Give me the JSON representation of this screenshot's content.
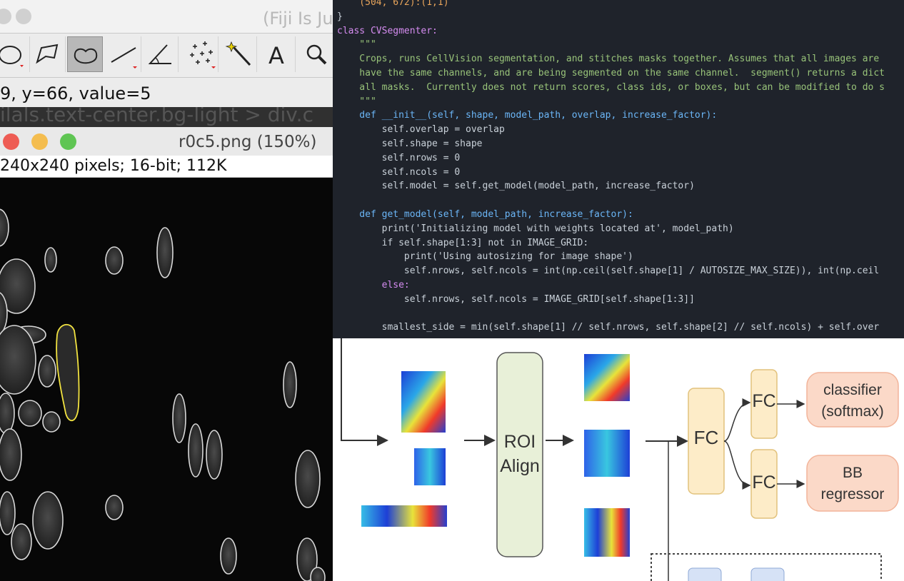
{
  "fiji": {
    "title": "(Fiji Is Ju",
    "status": "9, y=66, value=5",
    "dev_breadcrumb": "ilals.text-center.bg-light  >  div.c",
    "tools": [
      {
        "name": "oval-selection",
        "icon": "oval-selection-icon"
      },
      {
        "name": "polygon-selection",
        "icon": "polygon-selection-icon"
      },
      {
        "name": "freehand-selection",
        "icon": "freehand-selection-icon",
        "active": true
      },
      {
        "name": "line-selection",
        "icon": "line-icon"
      },
      {
        "name": "angle-tool",
        "icon": "angle-icon"
      },
      {
        "name": "multi-point-tool",
        "icon": "multipoint-icon"
      },
      {
        "name": "wand-tool",
        "icon": "wand-icon"
      },
      {
        "name": "text-tool",
        "icon": "text-icon"
      },
      {
        "name": "magnifier-tool",
        "icon": "magnifier-icon"
      }
    ]
  },
  "image_window": {
    "title": "r0c5.png (150%)",
    "info": "240x240 pixels; 16-bit; 112K"
  },
  "code": {
    "lines": [
      "    (504, 672):(1,1)",
      "}",
      "class CVSegmenter:",
      "    \"\"\"",
      "    Crops, runs CellVision segmentation, and stitches masks together. Assumes that all images are",
      "    have the same channels, and are being segmented on the same channel.  segment() returns a dict",
      "    all masks.  Currently does not return scores, class ids, or boxes, but can be modified to do s",
      "    \"\"\"",
      "    def __init__(self, shape, model_path, overlap, increase_factor):",
      "        self.overlap = overlap",
      "        self.shape = shape",
      "        self.nrows = 0",
      "        self.ncols = 0",
      "        self.model = self.get_model(model_path, increase_factor)",
      "",
      "    def get_model(self, model_path, increase_factor):",
      "        print('Initializing model with weights located at', model_path)",
      "        if self.shape[1:3] not in IMAGE_GRID:",
      "            print('Using autosizing for image shape')",
      "            self.nrows, self.ncols = int(np.ceil(self.shape[1] / AUTOSIZE_MAX_SIZE)), int(np.ceil",
      "        else:",
      "            self.nrows, self.ncols = IMAGE_GRID[self.shape[1:3]]",
      "",
      "        smallest_side = min(self.shape[1] // self.nrows, self.shape[2] // self.ncols) + self.over"
    ]
  },
  "diagram": {
    "roi_align": "ROI\nAlign",
    "fc_main": "FC",
    "fc_top": "FC",
    "fc_bottom": "FC",
    "classifier": "classifier\n(softmax)",
    "bb_regressor": "BB\nregressor"
  },
  "colors": {
    "close": "#ee5c54",
    "minimize": "#f4bd4f",
    "zoom": "#5fc553",
    "roi_fill": "#e8f0d8",
    "fc_fill": "#fdecc8",
    "out_fill": "#fbd9c8",
    "cell_outline": "#d8d8d8",
    "selected_outline": "#f2e341"
  }
}
